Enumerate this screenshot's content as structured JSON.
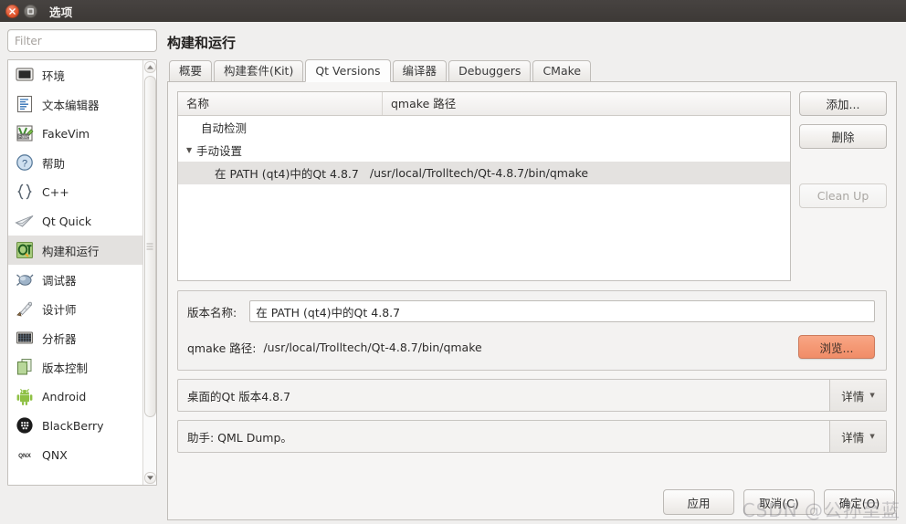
{
  "window": {
    "title": "选项",
    "close_icon": "close-icon",
    "maximize_icon": "maximize-icon"
  },
  "sidebar": {
    "filter_placeholder": "Filter",
    "filter_value": "",
    "items": [
      {
        "label": "环境",
        "icon": "monitor-icon",
        "selected": false
      },
      {
        "label": "文本编辑器",
        "icon": "text-editor-icon",
        "selected": false
      },
      {
        "label": "FakeVim",
        "icon": "fakevim-icon",
        "selected": false
      },
      {
        "label": "帮助",
        "icon": "help-question-icon",
        "selected": false
      },
      {
        "label": "C++",
        "icon": "braces-icon",
        "selected": false
      },
      {
        "label": "Qt Quick",
        "icon": "paper-plane-icon",
        "selected": false
      },
      {
        "label": "构建和运行",
        "icon": "qt-logo-icon",
        "selected": true
      },
      {
        "label": "调试器",
        "icon": "bug-icon",
        "selected": false
      },
      {
        "label": "设计师",
        "icon": "designer-brush-icon",
        "selected": false
      },
      {
        "label": "分析器",
        "icon": "analyzer-grid-icon",
        "selected": false
      },
      {
        "label": "版本控制",
        "icon": "version-control-icon",
        "selected": false
      },
      {
        "label": "Android",
        "icon": "android-icon",
        "selected": false
      },
      {
        "label": "BlackBerry",
        "icon": "blackberry-icon",
        "selected": false
      },
      {
        "label": "QNX",
        "icon": "qnx-icon",
        "selected": false
      }
    ]
  },
  "main": {
    "page_title": "构建和运行",
    "tabs": [
      {
        "label": "概要",
        "active": false
      },
      {
        "label": "构建套件(Kit)",
        "active": false
      },
      {
        "label": "Qt Versions",
        "active": true
      },
      {
        "label": "编译器",
        "active": false
      },
      {
        "label": "Debuggers",
        "active": false
      },
      {
        "label": "CMake",
        "active": false
      }
    ],
    "tree": {
      "columns": [
        "名称",
        "qmake 路径"
      ],
      "rows": [
        {
          "name": "自动检测",
          "path": "",
          "level": 1,
          "expander": "",
          "selected": false
        },
        {
          "name": "手动设置",
          "path": "",
          "level": 1,
          "expander": "▼",
          "selected": false
        },
        {
          "name": "在 PATH (qt4)中的Qt 4.8.7",
          "path": "/usr/local/Trolltech/Qt-4.8.7/bin/qmake",
          "level": 2,
          "expander": "",
          "selected": true
        }
      ]
    },
    "side_buttons": [
      {
        "label": "添加...",
        "disabled": false
      },
      {
        "label": "删除",
        "disabled": false
      },
      {
        "label": "Clean Up",
        "disabled": true
      }
    ],
    "form": {
      "version_name_label": "版本名称:",
      "version_name_value": "在 PATH (qt4)中的Qt 4.8.7",
      "qmake_path_label": "qmake 路径:",
      "qmake_path_value": "/usr/local/Trolltech/Qt-4.8.7/bin/qmake",
      "browse_label": "浏览...",
      "browse_color": "#f29a76"
    },
    "info_rows": [
      {
        "text": "桌面的Qt 版本4.8.7",
        "button": "详情"
      },
      {
        "text": "助手: QML Dump。",
        "button": "详情"
      }
    ]
  },
  "footer": {
    "buttons": [
      {
        "label": "应用"
      },
      {
        "label": "取消(C)"
      },
      {
        "label": "确定(O)"
      }
    ]
  },
  "watermark": {
    "text": "CSDN @公孙至蓝"
  }
}
